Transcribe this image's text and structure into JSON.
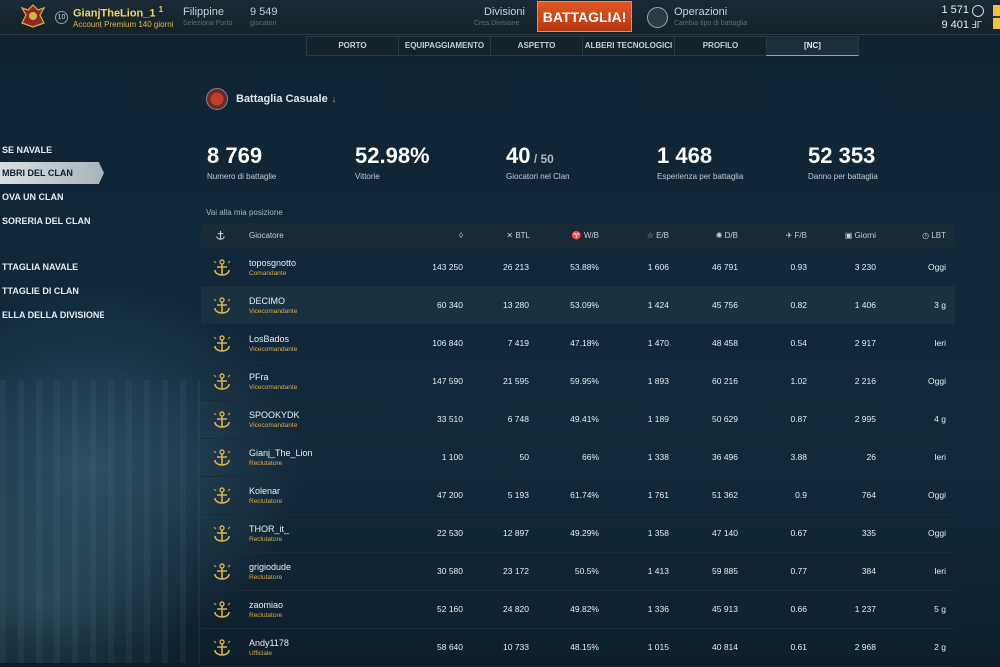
{
  "colors": {
    "accent": "#4ec9c4",
    "battle_button": "#d04a1c",
    "gold": "#f0d46a",
    "role": "#e0a84a"
  },
  "topbar": {
    "level": "10",
    "username": "GianjTheLion_1",
    "username_sup": "1",
    "account": "Account Premium 140 giorni",
    "port_label": "Filippine",
    "port_sub": "Seleziona Porto",
    "players_count": "9 549",
    "players_sub": "giocatori",
    "division_label": "Divisioni",
    "division_sub": "Crea Divisione",
    "battle_button": "BATTAGLIA!",
    "operations_label": "Operazioni",
    "operations_sub": "Cambia tipo di battaglia",
    "currency1": "1 571",
    "currency2": "9 401",
    "icons": {
      "emblem": "captain-emblem-icon",
      "operations": "operations-icon",
      "currency1": "doubloon-icon",
      "currency2": "credits-icon"
    }
  },
  "tabs": [
    {
      "label": "PORTO"
    },
    {
      "label": "EQUIPAGGIAMENTO"
    },
    {
      "label": "ASPETTO"
    },
    {
      "label": "ALBERI TECNOLOGICI"
    },
    {
      "label": "PROFILO"
    },
    {
      "label": "[NC]",
      "active": true
    }
  ],
  "sidebar": [
    {
      "label": "SE NAVALE"
    },
    {
      "label": "MBRI DEL CLAN",
      "active": true
    },
    {
      "label": "OVA UN CLAN"
    },
    {
      "label": "SORERIA DEL CLAN"
    },
    {
      "label": "TTAGLIA NAVALE"
    },
    {
      "label": "TTAGLIE DI CLAN"
    },
    {
      "label": "ELLA DELLA DIVISIONE"
    }
  ],
  "mode": {
    "title": "Battaglia Casuale",
    "arrow": "↓",
    "icon": "random-battle-icon"
  },
  "stats": [
    {
      "value": "8 769",
      "suffix": "",
      "label": "Numero di battaglie"
    },
    {
      "value": "52.98%",
      "suffix": "",
      "label": "Vittorie"
    },
    {
      "value": "40",
      "suffix": " / 50",
      "label": "Giocatori nel Clan"
    },
    {
      "value": "1 468",
      "suffix": "",
      "label": "Esperienza per battaglia"
    },
    {
      "value": "52 353",
      "suffix": "",
      "label": "Danno per battaglia"
    }
  ],
  "goto_position": "Vai alla mia posizione",
  "table": {
    "headers": [
      "Giocatore",
      "",
      "BTL",
      "W/B",
      "E/B",
      "D/B",
      "F/B",
      "Giorni",
      "LBT"
    ],
    "header_icons": [
      "anchor-icon",
      "droplet-icon",
      "crossed-swords-icon",
      "trophy-icon",
      "star-icon",
      "explosion-icon",
      "plane-icon",
      "calendar-icon",
      "clock-icon"
    ],
    "rows": [
      {
        "name": "toposgnotto",
        "role": "Comandante",
        "xp": "143 250",
        "btl": "26 213",
        "wb": "53.88%",
        "eb": "1 606",
        "db": "46 791",
        "fb": "0.93",
        "days": "3 230",
        "lbt": "Oggi"
      },
      {
        "name": "DECIMO",
        "role": "Vicecomandante",
        "xp": "60 340",
        "btl": "13 280",
        "wb": "53.09%",
        "eb": "1 424",
        "db": "45 756",
        "fb": "0.82",
        "days": "1 406",
        "lbt": "3 g",
        "hl": true
      },
      {
        "name": "LosBados",
        "role": "Vicecomandante",
        "xp": "106 840",
        "btl": "7 419",
        "wb": "47.18%",
        "eb": "1 470",
        "db": "48 458",
        "fb": "0.54",
        "days": "2 917",
        "lbt": "Ieri"
      },
      {
        "name": "PFra",
        "role": "Vicecomandante",
        "xp": "147 590",
        "btl": "21 595",
        "wb": "59.95%",
        "eb": "1 893",
        "db": "60 216",
        "fb": "1.02",
        "days": "2 216",
        "lbt": "Oggi"
      },
      {
        "name": "SPOOKYDK",
        "role": "Vicecomandante",
        "xp": "33 510",
        "btl": "6 748",
        "wb": "49.41%",
        "eb": "1 189",
        "db": "50 629",
        "fb": "0.87",
        "days": "2 995",
        "lbt": "4 g"
      },
      {
        "name": "Gianj_The_Lion",
        "role": "Reclutatore",
        "xp": "1 100",
        "btl": "50",
        "wb": "66%",
        "eb": "1 338",
        "db": "36 496",
        "fb": "3.88",
        "days": "26",
        "lbt": "Ieri"
      },
      {
        "name": "Kolenar",
        "role": "Reclutatore",
        "xp": "47 200",
        "btl": "5 193",
        "wb": "61.74%",
        "eb": "1 761",
        "db": "51 362",
        "fb": "0.9",
        "days": "764",
        "lbt": "Oggi"
      },
      {
        "name": "THOR_it_",
        "role": "Reclutatore",
        "xp": "22 530",
        "btl": "12 897",
        "wb": "49.29%",
        "eb": "1 358",
        "db": "47 140",
        "fb": "0.67",
        "days": "335",
        "lbt": "Oggi"
      },
      {
        "name": "grigiodude",
        "role": "Reclutatore",
        "xp": "30 580",
        "btl": "23 172",
        "wb": "50.5%",
        "eb": "1 413",
        "db": "59 885",
        "fb": "0.77",
        "days": "384",
        "lbt": "Ieri"
      },
      {
        "name": "zaomiao",
        "role": "Reclutatore",
        "xp": "52 160",
        "btl": "24 820",
        "wb": "49.82%",
        "eb": "1 336",
        "db": "45 913",
        "fb": "0.66",
        "days": "1 237",
        "lbt": "5 g"
      },
      {
        "name": "Andy1178",
        "role": "Ufficiale",
        "xp": "58 640",
        "btl": "10 733",
        "wb": "48.15%",
        "eb": "1 015",
        "db": "40 814",
        "fb": "0.61",
        "days": "2 968",
        "lbt": "2 g"
      }
    ]
  }
}
